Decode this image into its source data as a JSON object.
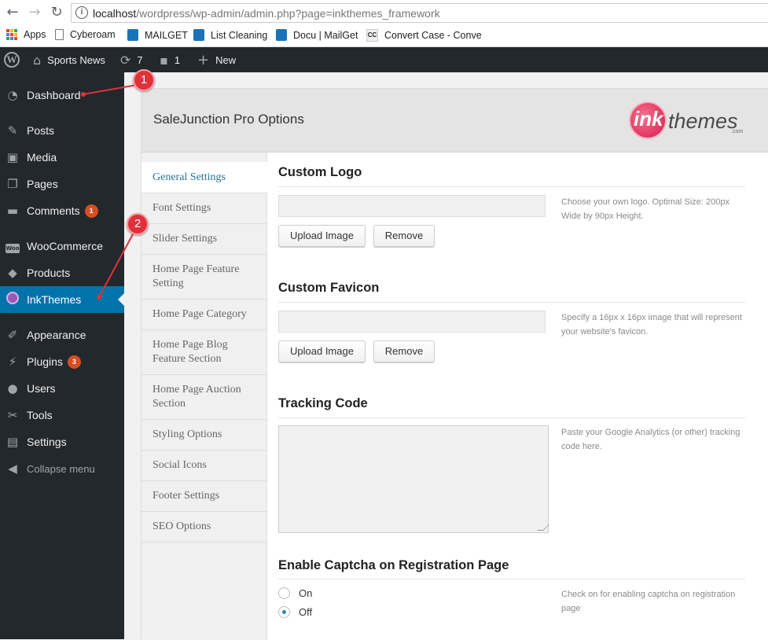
{
  "browser": {
    "url_host": "localhost",
    "url_path": "/wordpress/wp-admin/admin.php?page=inkthemes_framework",
    "bookmarks": [
      "Apps",
      "Cyberoam",
      "MAILGET",
      "List Cleaning",
      "Docu | MailGet",
      "Convert Case - Conve"
    ]
  },
  "adminbar": {
    "site_name": "Sports News",
    "updates_count": "7",
    "comments_count": "1",
    "new_label": "New"
  },
  "sidebar": {
    "items": [
      {
        "label": "Dashboard",
        "icon": "dashboard-icon"
      },
      {
        "label": "Posts",
        "icon": "pin-icon"
      },
      {
        "label": "Media",
        "icon": "media-icon"
      },
      {
        "label": "Pages",
        "icon": "pages-icon"
      },
      {
        "label": "Comments",
        "icon": "comment-icon",
        "badge": "1"
      },
      {
        "label": "WooCommerce",
        "icon": "woocommerce-icon"
      },
      {
        "label": "Products",
        "icon": "box-icon"
      },
      {
        "label": "InkThemes",
        "icon": "inkthemes-icon"
      },
      {
        "label": "Appearance",
        "icon": "brush-icon"
      },
      {
        "label": "Plugins",
        "icon": "plugin-icon",
        "badge": "3"
      },
      {
        "label": "Users",
        "icon": "user-icon"
      },
      {
        "label": "Tools",
        "icon": "wrench-icon"
      },
      {
        "label": "Settings",
        "icon": "settings-icon"
      },
      {
        "label": "Collapse menu",
        "icon": "collapse-icon"
      }
    ]
  },
  "panel": {
    "title": "SaleJunction Pro Options",
    "logo": {
      "ink": "ink",
      "themes": "themes",
      "com": ".com"
    }
  },
  "tabs": [
    "General Settings",
    "Font Settings",
    "Slider Settings",
    "Home Page Feature Setting",
    "Home Page Category",
    "Home Page Blog Feature Section",
    "Home Page Auction Section",
    "Styling Options",
    "Social Icons",
    "Footer Settings",
    "SEO Options"
  ],
  "sections": {
    "logo": {
      "title": "Custom Logo",
      "upload_label": "Upload Image",
      "remove_label": "Remove",
      "help": "Choose your own logo. Optimal Size: 200px Wide by 90px Height."
    },
    "favicon": {
      "title": "Custom Favicon",
      "upload_label": "Upload Image",
      "remove_label": "Remove",
      "help": "Specify a 16px x 16px image that will represent your website's favicon."
    },
    "tracking": {
      "title": "Tracking Code",
      "help": "Paste your Google Analytics (or other) tracking code here."
    },
    "captcha": {
      "title": "Enable Captcha on Registration Page",
      "on_label": "On",
      "off_label": "Off",
      "selected": "Off",
      "help": "Check on for enabling captcha on registration page"
    }
  },
  "annotations": [
    "1",
    "2"
  ],
  "colors": {
    "admin_dark": "#23282d",
    "accent_blue": "#0073aa",
    "badge_orange": "#d54e21",
    "annotation_red": "#e0303a"
  }
}
